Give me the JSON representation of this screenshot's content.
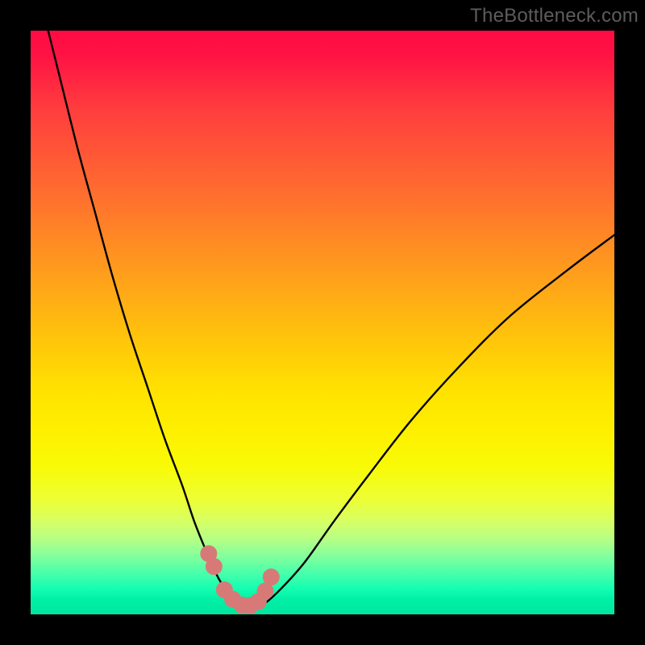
{
  "watermark": {
    "text": "TheBottleneck.com"
  },
  "colors": {
    "curve_stroke": "#000000",
    "marker_fill": "#d77a77",
    "marker_stroke": "#cf6a66",
    "background": "#000000"
  },
  "chart_data": {
    "type": "line",
    "title": "",
    "xlabel": "",
    "ylabel": "",
    "xlim": [
      0,
      100
    ],
    "ylim": [
      0,
      100
    ],
    "series": [
      {
        "name": "bottleneck-curve",
        "x": [
          3,
          5,
          8,
          11,
          14,
          17,
          20,
          23,
          26,
          28,
          30,
          31.5,
          33,
          34.5,
          36,
          38,
          40,
          43,
          47,
          52,
          58,
          65,
          73,
          82,
          92,
          100
        ],
        "y": [
          100,
          92,
          80,
          69,
          58,
          48,
          39,
          30,
          22,
          16,
          11,
          7.5,
          4.8,
          2.8,
          1.5,
          1,
          1.8,
          4.5,
          9,
          16,
          24,
          33,
          42,
          51,
          59,
          65
        ]
      }
    ],
    "markers": {
      "name": "highlighted-points",
      "x": [
        30.5,
        31.4,
        33.2,
        34.6,
        36.2,
        37.6,
        39.0,
        40.2,
        41.2
      ],
      "y": [
        10.4,
        8.2,
        4.2,
        2.6,
        1.6,
        1.5,
        2.2,
        4.0,
        6.4
      ]
    }
  }
}
